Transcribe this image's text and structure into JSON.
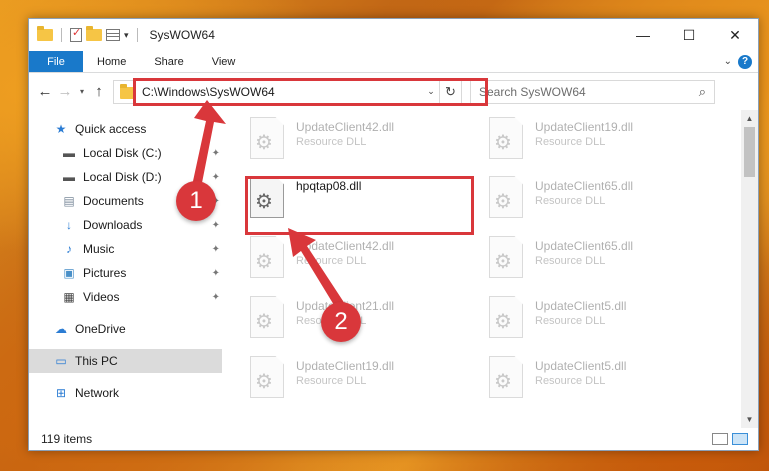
{
  "window": {
    "title": "SysWOW64",
    "controls": {
      "minimize": "—",
      "maximize": "☐",
      "close": "✕"
    }
  },
  "ribbon": {
    "tabs": [
      "File",
      "Home",
      "Share",
      "View"
    ],
    "help": "?"
  },
  "nav": {
    "back": "←",
    "forward": "→",
    "recent": "⌄",
    "up": "↑"
  },
  "address": {
    "path": "C:\\Windows\\SysWOW64",
    "refresh": "↻"
  },
  "search": {
    "placeholder": "Search SysWOW64",
    "icon": "⌕"
  },
  "sidebar": {
    "items": [
      {
        "label": "Quick access",
        "icon": "star-icon",
        "glyph": "★"
      },
      {
        "label": "Local Disk (C:)",
        "icon": "drive-icon",
        "glyph": "▬",
        "pinned": true
      },
      {
        "label": "Local Disk (D:)",
        "icon": "drive-icon",
        "glyph": "▬",
        "pinned": true
      },
      {
        "label": "Documents",
        "icon": "documents-icon",
        "glyph": "▤",
        "pinned": true
      },
      {
        "label": "Downloads",
        "icon": "downloads-icon",
        "glyph": "↓",
        "pinned": true
      },
      {
        "label": "Music",
        "icon": "music-icon",
        "glyph": "♪",
        "pinned": true
      },
      {
        "label": "Pictures",
        "icon": "pictures-icon",
        "glyph": "▣",
        "pinned": true
      },
      {
        "label": "Videos",
        "icon": "videos-icon",
        "glyph": "▦",
        "pinned": true
      },
      {
        "label": "OneDrive",
        "icon": "cloud-icon",
        "glyph": "☁"
      },
      {
        "label": "This PC",
        "icon": "computer-icon",
        "glyph": "▭"
      },
      {
        "label": "Network",
        "icon": "network-icon",
        "glyph": "⊞"
      }
    ],
    "pin_glyph": "📌"
  },
  "files": [
    {
      "name": "UpdateClient42.dll",
      "type": "Resource DLL"
    },
    {
      "name": "UpdateClient19.dll",
      "type": "Resource DLL"
    },
    {
      "name": "hpqtap08.dll",
      "type": ""
    },
    {
      "name": "UpdateClient65.dll",
      "type": "Resource DLL"
    },
    {
      "name": "UpdateClient42.dll",
      "type": "Resource DLL"
    },
    {
      "name": "UpdateClient65.dll",
      "type": "Resource DLL"
    },
    {
      "name": "UpdateClient21.dll",
      "type": "Resource DLL"
    },
    {
      "name": "UpdateClient5.dll",
      "type": "Resource DLL"
    },
    {
      "name": "UpdateClient19.dll",
      "type": "Resource DLL"
    },
    {
      "name": "UpdateClient5.dll",
      "type": "Resource DLL"
    }
  ],
  "status": {
    "count": "119 items"
  },
  "annotations": {
    "step1": "1",
    "step2": "2",
    "color": "#d9373b"
  },
  "colors": {
    "accent": "#1979ca"
  }
}
